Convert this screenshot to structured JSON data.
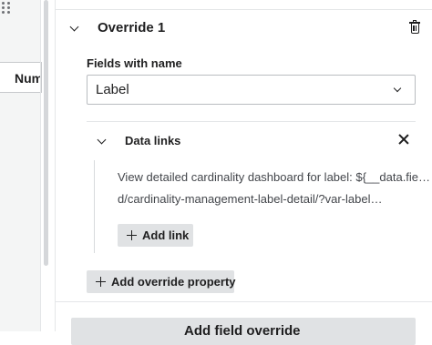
{
  "left_column": {
    "header_truncated": "Num"
  },
  "override": {
    "title": "Override 1",
    "fields_label": "Fields with name",
    "selected_field": "Label",
    "data_links": {
      "title": "Data links",
      "link_title": "View detailed cardinality dashboard for label: ${__data.fiel…",
      "link_url": "d/cardinality-management-label-detail/?var-label…",
      "add_link_label": "Add link"
    },
    "add_property_label": "Add override property"
  },
  "add_field_override_label": "Add field override",
  "icons": {
    "collapse": "chevron-down-icon",
    "delete": "trash-icon",
    "close": "close-icon",
    "add": "plus-icon",
    "drag": "drag-handle-icon"
  }
}
